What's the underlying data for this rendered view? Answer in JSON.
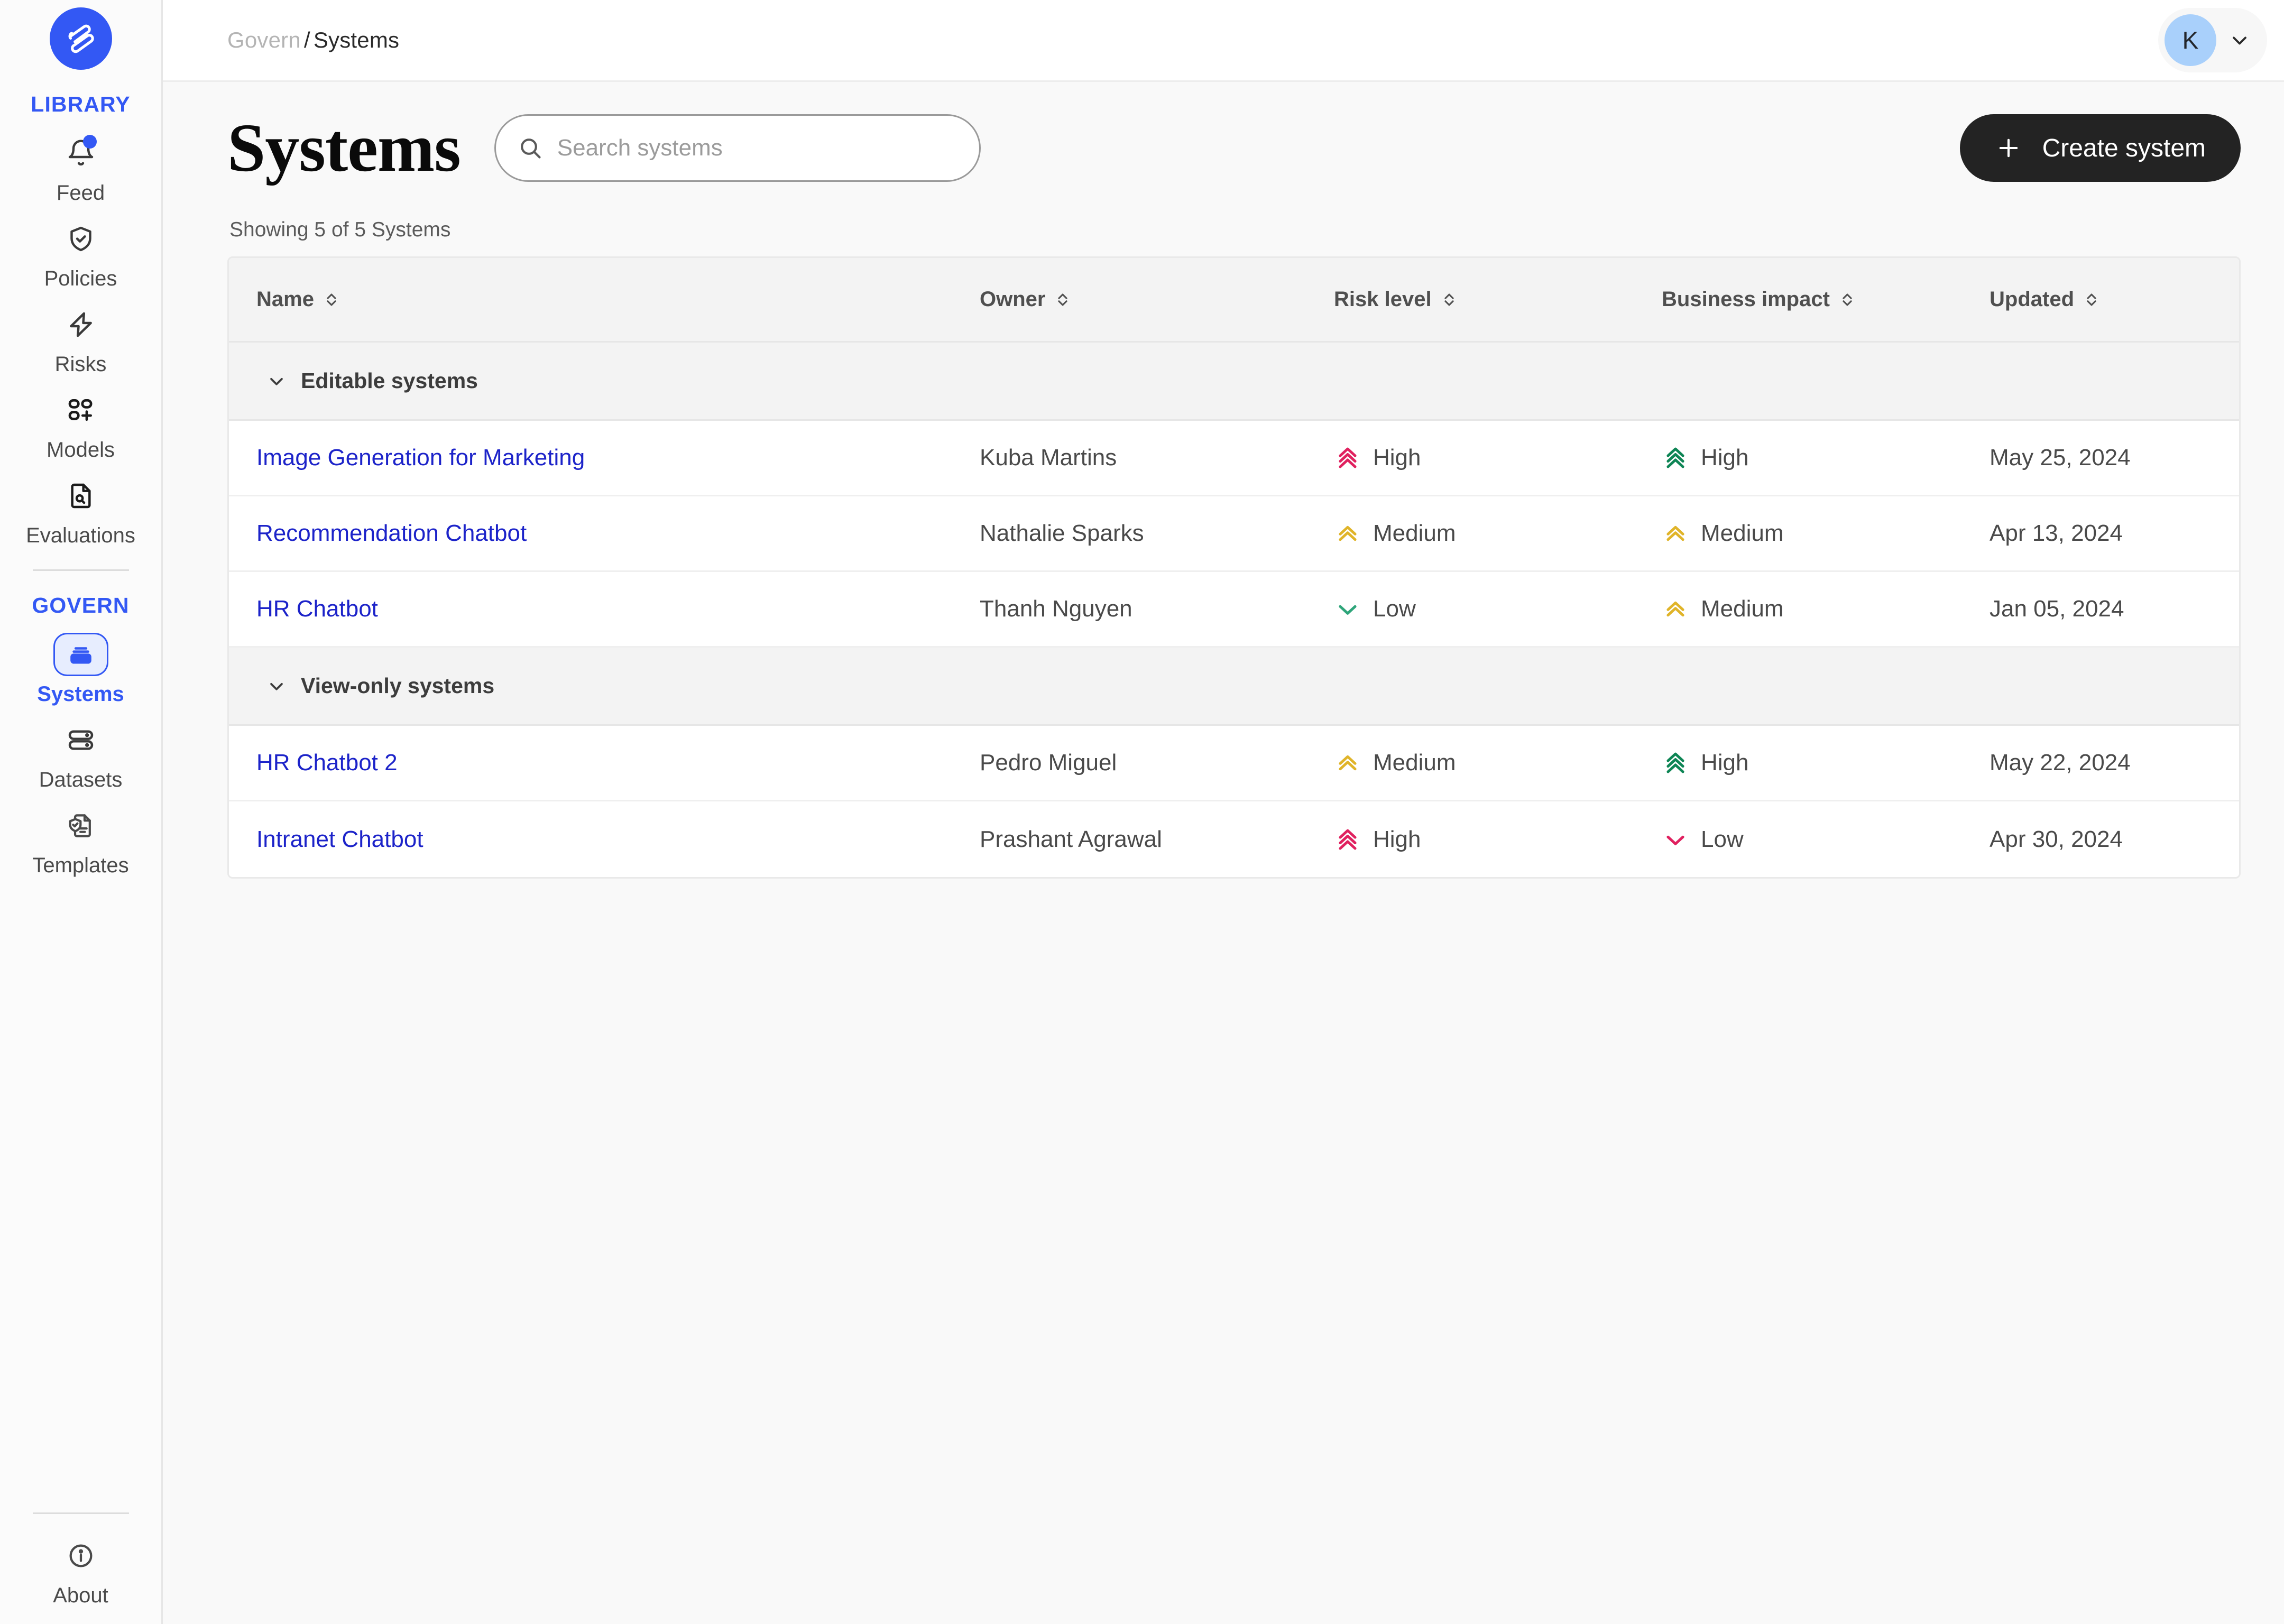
{
  "brand": {
    "logo_icon": "validmind-logo-icon",
    "accent_color": "#3358f4",
    "link_color": "#1c23c9"
  },
  "sidebar": {
    "sections": [
      {
        "label": "LIBRARY",
        "items": [
          {
            "label": "Feed",
            "icon": "bell-icon",
            "active": false,
            "badge": true
          },
          {
            "label": "Policies",
            "icon": "shield-check-icon",
            "active": false,
            "badge": false
          },
          {
            "label": "Risks",
            "icon": "lightning-bolt-icon",
            "active": false,
            "badge": false
          },
          {
            "label": "Models",
            "icon": "models-grid-plus-icon",
            "active": false,
            "badge": false
          },
          {
            "label": "Evaluations",
            "icon": "document-search-icon",
            "active": false,
            "badge": false
          }
        ]
      },
      {
        "label": "GOVERN",
        "items": [
          {
            "label": "Systems",
            "icon": "systems-stack-icon",
            "active": true,
            "badge": false
          },
          {
            "label": "Datasets",
            "icon": "database-icon",
            "active": false,
            "badge": false
          },
          {
            "label": "Templates",
            "icon": "template-shield-document-icon",
            "active": false,
            "badge": false
          }
        ]
      }
    ],
    "footer": {
      "label": "About",
      "icon": "info-circle-icon"
    }
  },
  "topbar": {
    "breadcrumb": {
      "parent": "Govern",
      "separator": "/",
      "current": "Systems"
    },
    "user": {
      "initial": "K",
      "chevron_icon": "chevron-down-icon"
    }
  },
  "page": {
    "title": "Systems",
    "search": {
      "placeholder": "Search systems",
      "value": "",
      "icon": "search-icon"
    },
    "create_button": {
      "label": "Create system",
      "icon": "plus-icon"
    },
    "showing": "Showing 5 of 5 Systems"
  },
  "table": {
    "columns": [
      {
        "label": "Name",
        "sort_icon": "sort-updown-icon"
      },
      {
        "label": "Owner",
        "sort_icon": "sort-updown-icon"
      },
      {
        "label": "Risk level",
        "sort_icon": "sort-updown-icon"
      },
      {
        "label": "Business impact",
        "sort_icon": "sort-updown-icon"
      },
      {
        "label": "Updated",
        "sort_icon": "sort-updown-icon"
      }
    ],
    "groups": [
      {
        "label": "Editable systems",
        "collapse_icon": "chevron-down-icon",
        "rows": [
          {
            "name": "Image Generation for Marketing",
            "owner": "Kuba Martins",
            "risk_level": {
              "text": "High",
              "icon": "chevrons-up-triple-icon",
              "color": "#e0215f"
            },
            "business_impact": {
              "text": "High",
              "icon": "chevrons-up-triple-icon",
              "color": "#0e8555"
            },
            "updated": "May 25, 2024"
          },
          {
            "name": "Recommendation Chatbot",
            "owner": "Nathalie Sparks",
            "risk_level": {
              "text": "Medium",
              "icon": "chevrons-up-double-icon",
              "color": "#e0b429"
            },
            "business_impact": {
              "text": "Medium",
              "icon": "chevrons-up-double-icon",
              "color": "#e0b429"
            },
            "updated": "Apr 13, 2024"
          },
          {
            "name": "HR Chatbot",
            "owner": "Thanh Nguyen",
            "risk_level": {
              "text": "Low",
              "icon": "chevron-down-single-icon",
              "color": "#2ea57a"
            },
            "business_impact": {
              "text": "Medium",
              "icon": "chevrons-up-double-icon",
              "color": "#e0b429"
            },
            "updated": "Jan 05, 2024"
          }
        ]
      },
      {
        "label": "View-only systems",
        "collapse_icon": "chevron-down-icon",
        "rows": [
          {
            "name": "HR Chatbot 2",
            "owner": "Pedro Miguel",
            "risk_level": {
              "text": "Medium",
              "icon": "chevrons-up-double-icon",
              "color": "#e0b429"
            },
            "business_impact": {
              "text": "High",
              "icon": "chevrons-up-triple-icon",
              "color": "#0e8555"
            },
            "updated": "May 22, 2024"
          },
          {
            "name": "Intranet Chatbot",
            "owner": "Prashant Agrawal",
            "risk_level": {
              "text": "High",
              "icon": "chevrons-up-triple-icon",
              "color": "#e0215f"
            },
            "business_impact": {
              "text": "Low",
              "icon": "chevron-down-single-icon",
              "color": "#e0215f"
            },
            "updated": "Apr 30, 2024"
          }
        ]
      }
    ]
  }
}
